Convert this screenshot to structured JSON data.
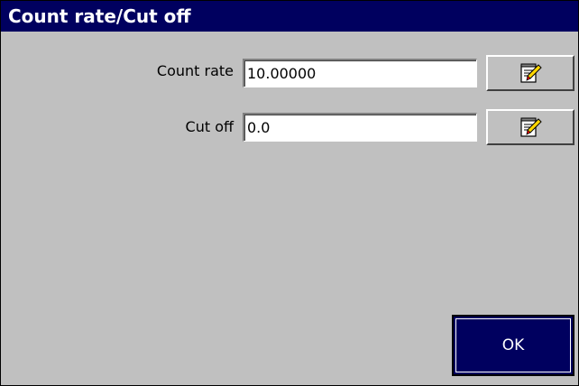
{
  "window": {
    "title": "Count rate/Cut off"
  },
  "fields": [
    {
      "label": "Count rate",
      "value": "10.00000",
      "edit_icon": "notepad-edit-icon"
    },
    {
      "label": "Cut off",
      "value": "0.0",
      "edit_icon": "notepad-edit-icon"
    }
  ],
  "buttons": {
    "ok_label": "OK"
  },
  "colors": {
    "titlebar": "#00005f",
    "background": "#c0c0c0",
    "ok_button": "#00005f"
  }
}
